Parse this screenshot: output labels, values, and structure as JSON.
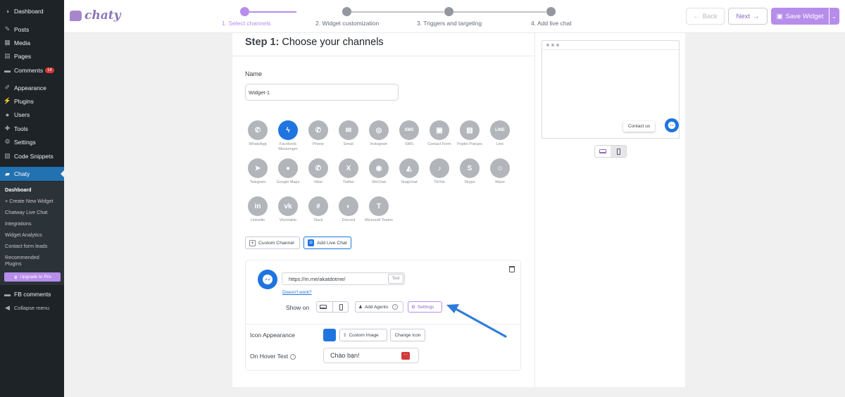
{
  "sidebar": {
    "items": [
      {
        "label": "Dashboard",
        "icon": "dashboard-icon"
      },
      {
        "label": "Posts",
        "icon": "pin-icon"
      },
      {
        "label": "Media",
        "icon": "media-icon"
      },
      {
        "label": "Pages",
        "icon": "pages-icon"
      },
      {
        "label": "Comments",
        "icon": "comment-icon",
        "badge": "14"
      },
      {
        "label": "Appearance",
        "icon": "brush-icon"
      },
      {
        "label": "Plugins",
        "icon": "plug-icon"
      },
      {
        "label": "Users",
        "icon": "user-icon"
      },
      {
        "label": "Tools",
        "icon": "wrench-icon"
      },
      {
        "label": "Settings",
        "icon": "settings-icon"
      },
      {
        "label": "Code Snippets",
        "icon": "code-icon"
      },
      {
        "label": "Chaty",
        "icon": "chat-icon"
      },
      {
        "label": "FB comments",
        "icon": "comment-icon"
      },
      {
        "label": "Collapse menu",
        "icon": "collapse-icon"
      }
    ],
    "submenu": [
      "Dashboard",
      "+ Create New Widget",
      "Chatway Live Chat",
      "Integrations",
      "Widget Analytics",
      "Contact form leads",
      "Recommended Plugins"
    ],
    "upgrade": "Upgrade to Pro",
    "accent": "#2271b1"
  },
  "header": {
    "logo": "chaty",
    "steps": [
      "1. Select channels",
      "2. Widget customization",
      "3. Triggers and targeting",
      "4. Add live chat"
    ],
    "back": "Back",
    "next": "Next",
    "save": "Save Widget",
    "accent": "#b78deb"
  },
  "main": {
    "title_bold": "Step 1:",
    "title_rest": "Choose your channels",
    "name_label": "Name",
    "name_value": "Widget-1",
    "channels": [
      {
        "label": "WhatsApp",
        "glyph": "✆"
      },
      {
        "label": "Facebook Messenger",
        "glyph": "ϟ",
        "selected": true
      },
      {
        "label": "Phone",
        "glyph": "✆"
      },
      {
        "label": "Email",
        "glyph": "✉"
      },
      {
        "label": "Instagram",
        "glyph": "◎"
      },
      {
        "label": "SMS",
        "glyph": "SMS"
      },
      {
        "label": "Contact Form",
        "glyph": "▣"
      },
      {
        "label": "Poptin Popups",
        "glyph": "▤"
      },
      {
        "label": "Line",
        "glyph": "LINE"
      },
      {
        "label": "Telegram",
        "glyph": "➤"
      },
      {
        "label": "Google Maps",
        "glyph": "●"
      },
      {
        "label": "Viber",
        "glyph": "✆"
      },
      {
        "label": "Twitter",
        "glyph": "X"
      },
      {
        "label": "WeChat",
        "glyph": "◉"
      },
      {
        "label": "Snapchat",
        "glyph": "◭"
      },
      {
        "label": "TikTok",
        "glyph": "♪"
      },
      {
        "label": "Skype",
        "glyph": "S"
      },
      {
        "label": "Waze",
        "glyph": "☺"
      },
      {
        "label": "Linkedin",
        "glyph": "in"
      },
      {
        "label": "Vkontakte",
        "glyph": "vk"
      },
      {
        "label": "Slack",
        "glyph": "#"
      },
      {
        "label": "Discord",
        "glyph": "◐"
      },
      {
        "label": "Microsoft Teams",
        "glyph": "T"
      }
    ],
    "custom_channel": "Custom Channel",
    "add_live_chat": "Add Live Chat",
    "channel_url": "https://m.me/akatdotme/",
    "test": "Test",
    "doesnt_work": "Doesn't work?",
    "show_on": "Show on",
    "add_agents": "Add Agents",
    "settings": "Settings",
    "icon_appearance": "Icon Appearance",
    "custom_image": "Custom Image",
    "change_icon": "Change Icon",
    "on_hover_text": "On Hover Text",
    "hover_value": "Chào bạn!",
    "channel_color": "#1f75e0"
  },
  "preview": {
    "contact_us": "Contact us"
  }
}
